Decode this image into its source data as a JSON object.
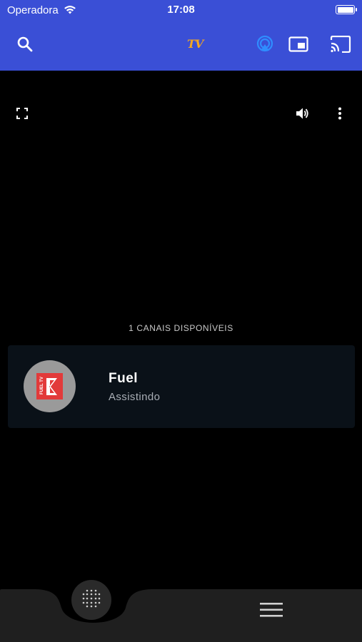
{
  "status_bar": {
    "carrier": "Operadora",
    "time": "17:08"
  },
  "app_bar": {
    "logo_text": "TV",
    "icons": [
      "search-icon",
      "airplay-icon",
      "picture-in-picture-icon",
      "cast-icon"
    ],
    "accent_color": "#3a4fd6",
    "logo_color": "#f2a623"
  },
  "player": {
    "icons": [
      "fullscreen-icon",
      "volume-icon",
      "more-vert-icon"
    ]
  },
  "channels": {
    "count_label": "1 CANAIS DISPONÍVEIS",
    "items": [
      {
        "name": "Fuel",
        "status": "Assistindo",
        "logo_icon": "fuel-tv-logo",
        "logo_text": "FUEL TV"
      }
    ]
  },
  "bottom_nav": {
    "icons": [
      "dots-grid-icon",
      "hamburger-menu-icon"
    ]
  }
}
